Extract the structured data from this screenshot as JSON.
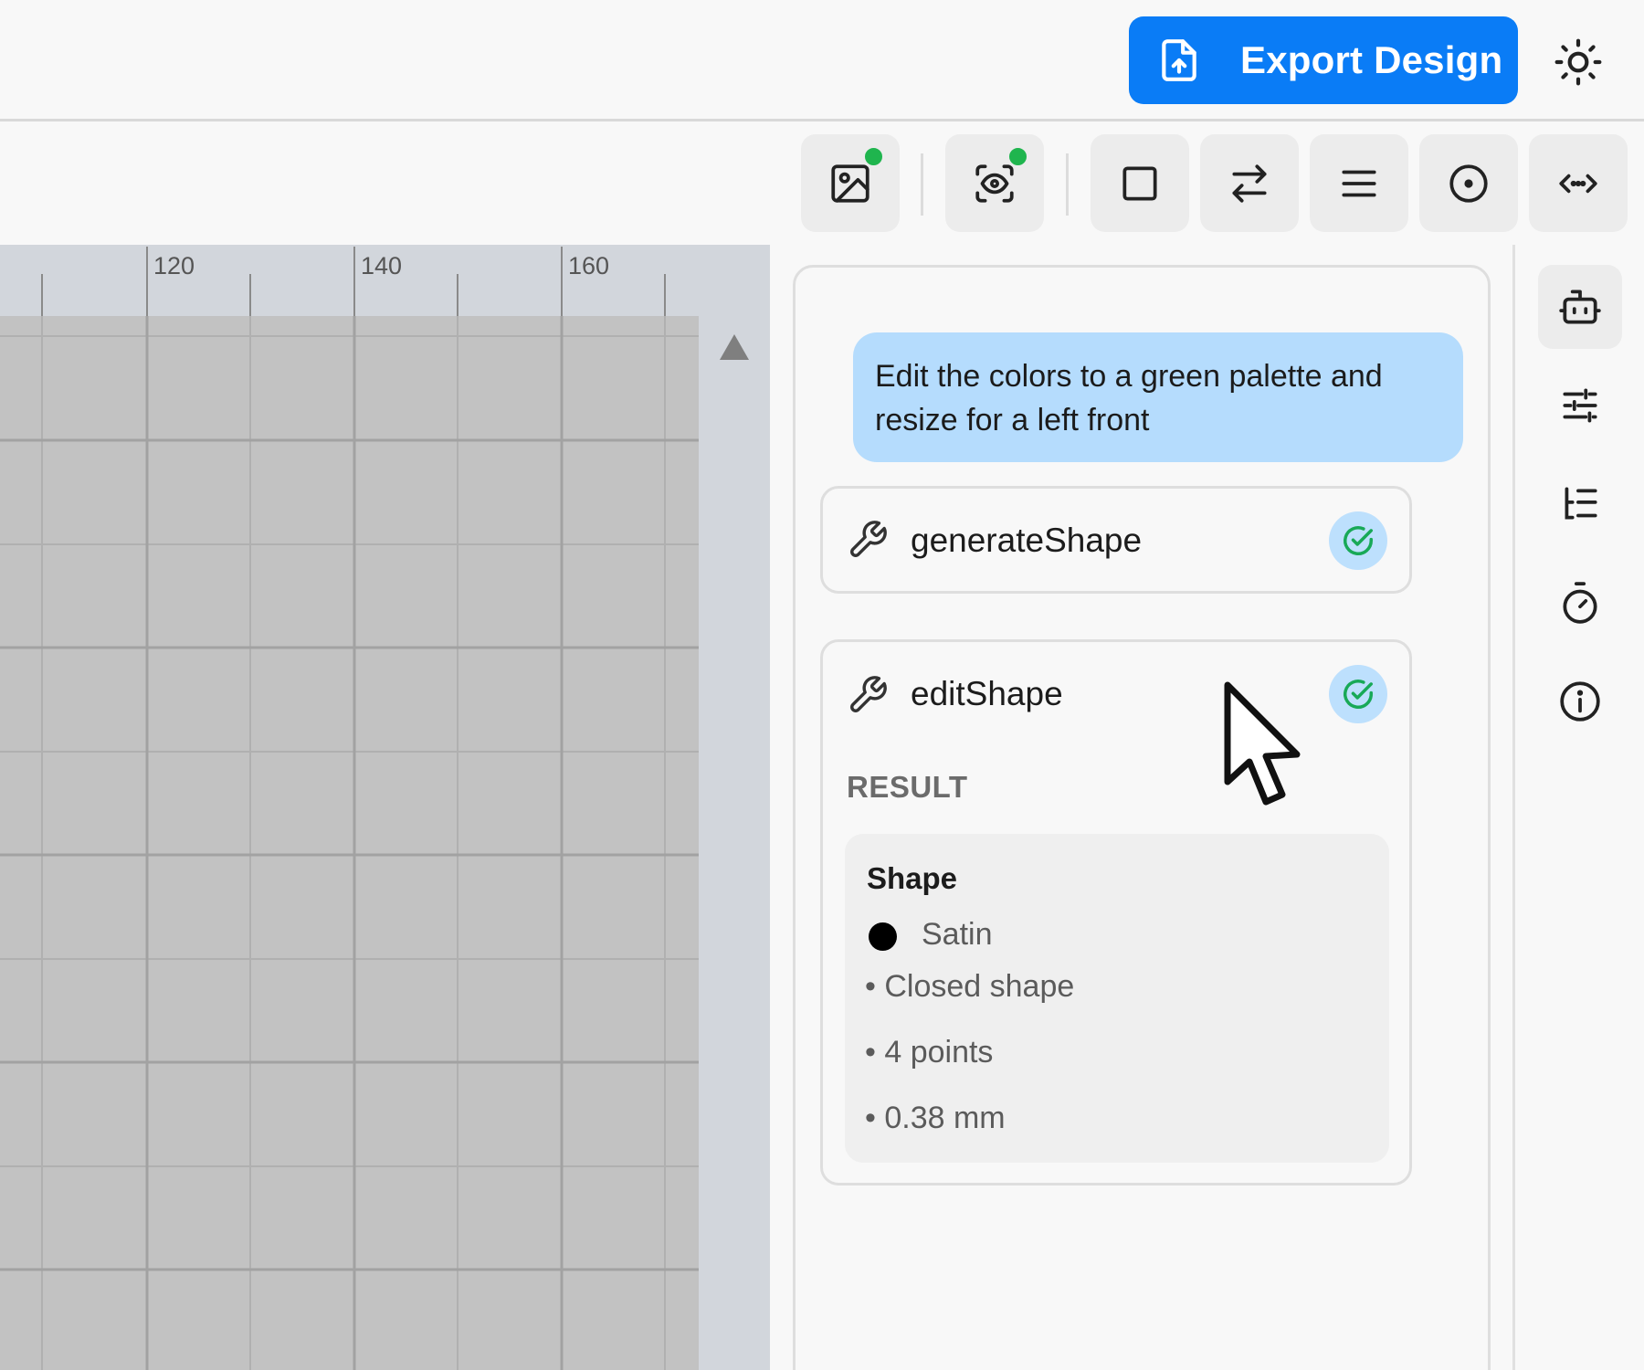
{
  "header": {
    "export_label": "Export Design",
    "export_color": "#0a7cf6"
  },
  "toolbar": {
    "buttons": [
      {
        "icon": "image-icon",
        "status": "active-green"
      },
      {
        "icon": "eye-scan-icon",
        "status": "active-green"
      },
      {
        "icon": "square-icon"
      },
      {
        "icon": "swap-arrows-icon"
      },
      {
        "icon": "menu-lines-icon"
      },
      {
        "icon": "target-circle-icon"
      },
      {
        "icon": "code-arrows-icon"
      }
    ]
  },
  "canvas": {
    "ruler_labels": [
      "120",
      "140",
      "160"
    ]
  },
  "chat": {
    "user_message": "Edit the colors to a green palette and resize for a left front",
    "tools": [
      {
        "name": "generateShape",
        "status": "done"
      },
      {
        "name": "editShape",
        "status": "done"
      }
    ],
    "result": {
      "label": "RESULT",
      "title": "Shape",
      "stitch": "Satin",
      "stitch_color": "#000000",
      "items": [
        "• Closed shape",
        "• 4 points",
        "• 0.38 mm"
      ]
    }
  },
  "rail": {
    "buttons": [
      "robot-icon",
      "sliders-icon",
      "tree-list-icon",
      "stopwatch-icon",
      "info-icon"
    ]
  }
}
